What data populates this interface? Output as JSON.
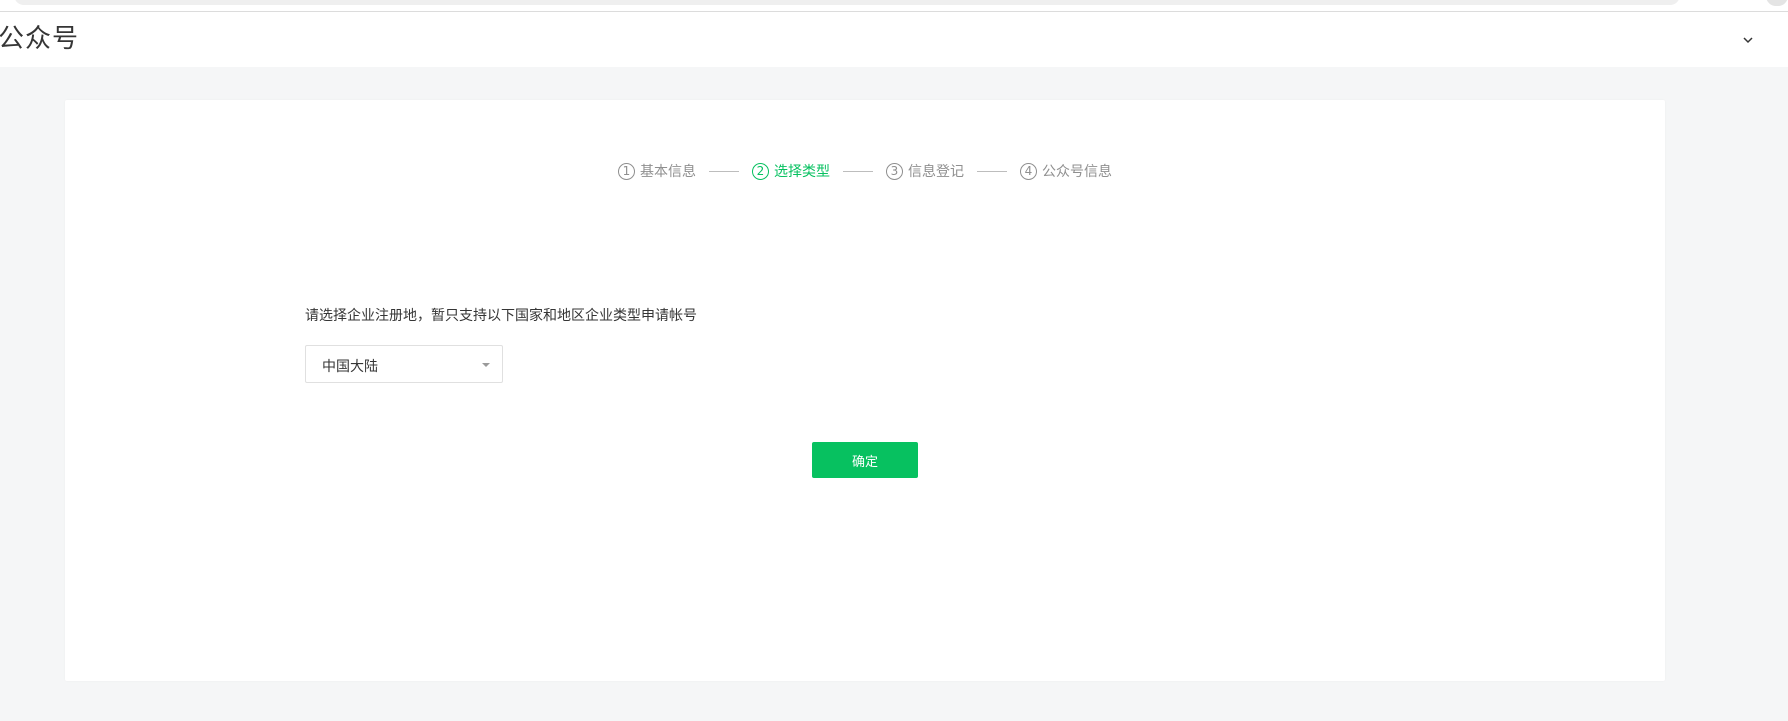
{
  "header": {
    "title": "公众号"
  },
  "steps": [
    {
      "number": "1",
      "label": "基本信息",
      "active": false
    },
    {
      "number": "2",
      "label": "选择类型",
      "active": true
    },
    {
      "number": "3",
      "label": "信息登记",
      "active": false
    },
    {
      "number": "4",
      "label": "公众号信息",
      "active": false
    }
  ],
  "form": {
    "prompt": "请选择企业注册地，暂只支持以下国家和地区企业类型申请帐号",
    "region_select_value": "中国大陆"
  },
  "actions": {
    "confirm_label": "确定"
  },
  "colors": {
    "accent": "#07c160",
    "inactive_step": "#8f8f8f",
    "page_background": "#f5f6f7",
    "card_background": "#ffffff"
  },
  "icons": {
    "header_menu": "chevron-down-icon",
    "select_indicator": "caret-down-icon"
  }
}
